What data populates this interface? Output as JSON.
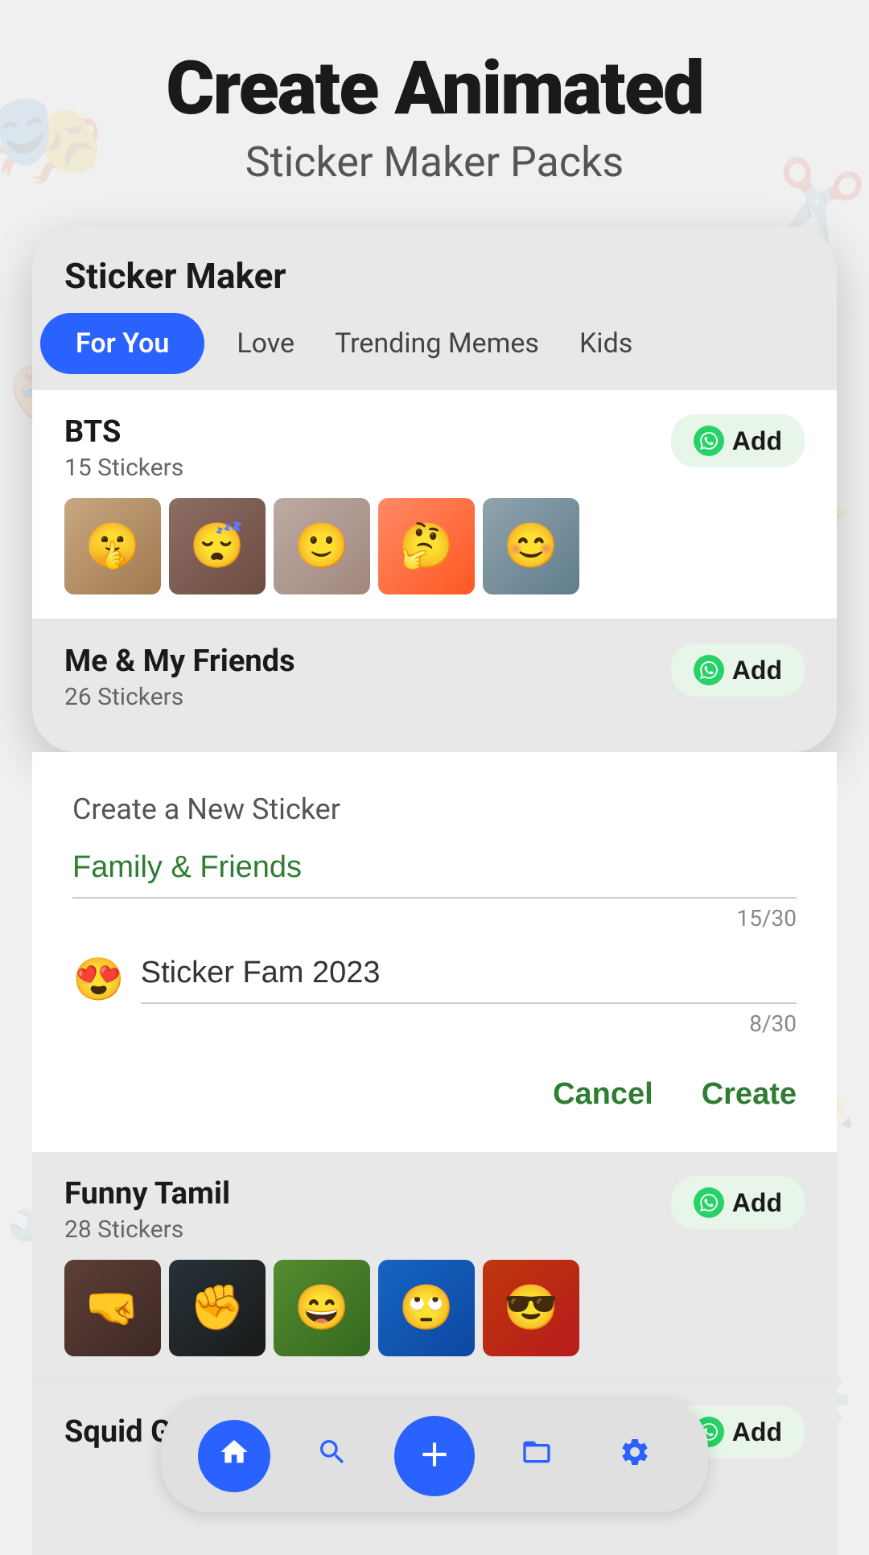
{
  "header": {
    "title_line1": "Create Animated",
    "title_line2": "Sticker Maker Packs"
  },
  "phone": {
    "app_title": "Sticker Maker",
    "tabs": [
      {
        "label": "For You",
        "active": true
      },
      {
        "label": "Love",
        "active": false
      },
      {
        "label": "Trending Memes",
        "active": false
      },
      {
        "label": "Kids",
        "active": false
      }
    ]
  },
  "sticker_packs": [
    {
      "name": "BTS",
      "count": "15 Stickers",
      "add_label": "Add"
    },
    {
      "name": "Me & My Friends",
      "count": "26 Stickers",
      "add_label": "Add"
    },
    {
      "name": "Funny Tamil",
      "count": "28 Stickers",
      "add_label": "Add"
    },
    {
      "name": "Squid Game",
      "add_label": "Add"
    }
  ],
  "create_section": {
    "label": "Create a New Sticker",
    "pack1": {
      "value": "Family & Friends",
      "counter": "15/30"
    },
    "pack2": {
      "emoji": "😍",
      "value": "Sticker Fam 2023",
      "counter": "8/30"
    },
    "cancel_label": "Cancel",
    "create_label": "Create"
  },
  "bottom_nav": {
    "items": [
      {
        "icon": "home",
        "label": "Home",
        "active": true
      },
      {
        "icon": "search",
        "label": "Search",
        "active": false
      },
      {
        "icon": "add",
        "label": "Add",
        "active": false
      },
      {
        "icon": "folder",
        "label": "My Packs",
        "active": false
      },
      {
        "icon": "settings",
        "label": "Settings",
        "active": false
      }
    ]
  }
}
